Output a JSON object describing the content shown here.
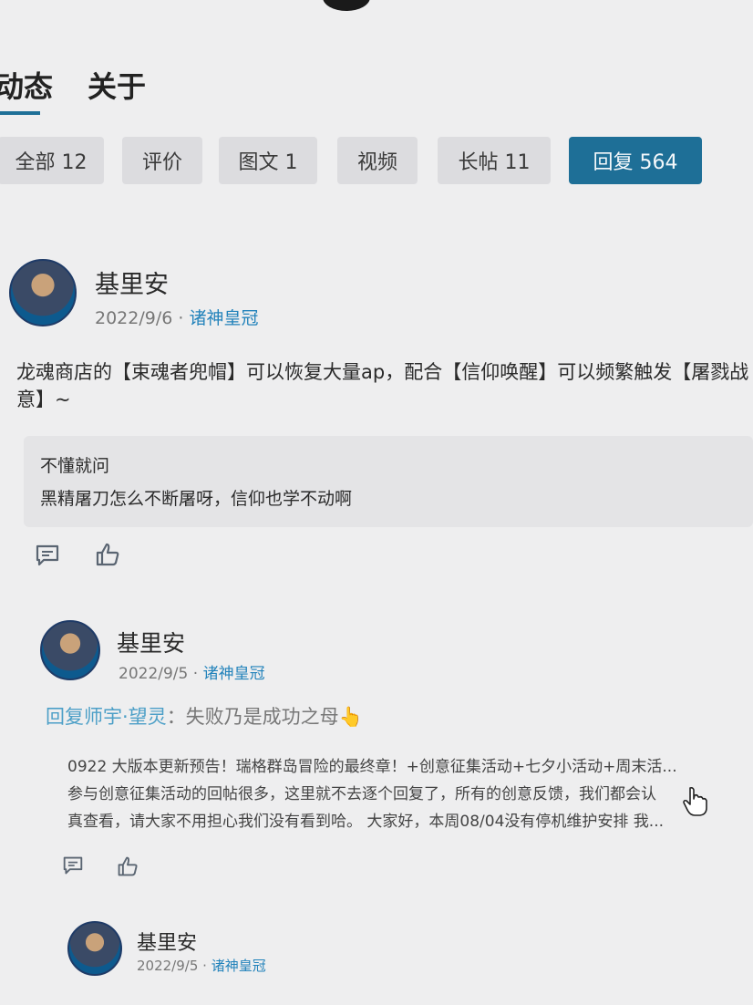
{
  "top_tabs": [
    {
      "label": "动态"
    },
    {
      "label": "关于"
    }
  ],
  "filters": [
    {
      "label": "全部 12"
    },
    {
      "label": "评价"
    },
    {
      "label": "图文 1"
    },
    {
      "label": "视频"
    },
    {
      "label": "长帖 11"
    },
    {
      "label": "回复 564"
    }
  ],
  "post1": {
    "author": "基里安",
    "date": "2022/9/6",
    "sep": " · ",
    "game": "诸神皇冠",
    "body_line1": "龙魂商店的【束魂者兜帽】可以恢复大量ap，配合【信仰唤醒】可以频繁触发【屠戮战",
    "body_line2": "意】~",
    "quote_line1": "不懂就问",
    "quote_line2": "黑精屠刀怎么不断屠呀，信仰也学不动啊"
  },
  "post2": {
    "author": "基里安",
    "date": "2022/9/5",
    "sep": " · ",
    "game": "诸神皇冠",
    "reply_label": "回复",
    "reply_user": "师宇·望灵",
    "reply_text": "：失败乃是成功之母👆",
    "snippet_line1": "0922 大版本更新预告！瑞格群岛冒险的最终章！+创意征集活动+七夕小活动+周末活...",
    "snippet_line2": "参与创意征集活动的回帖很多，这里就不去逐个回复了，所有的创意反馈，我们都会认",
    "snippet_line3": "真查看，请大家不用担心我们没有看到哈。 大家好，本周08/04没有停机维护安排 我..."
  },
  "post3": {
    "author": "基里安",
    "date": "2022/9/5",
    "sep": " · ",
    "game": "诸神皇冠"
  },
  "colors": {
    "accent": "#1e6f97",
    "link": "#2383bb",
    "background": "#eeeeef"
  },
  "icons": [
    "comment-icon",
    "like-icon",
    "cursor-icon"
  ]
}
